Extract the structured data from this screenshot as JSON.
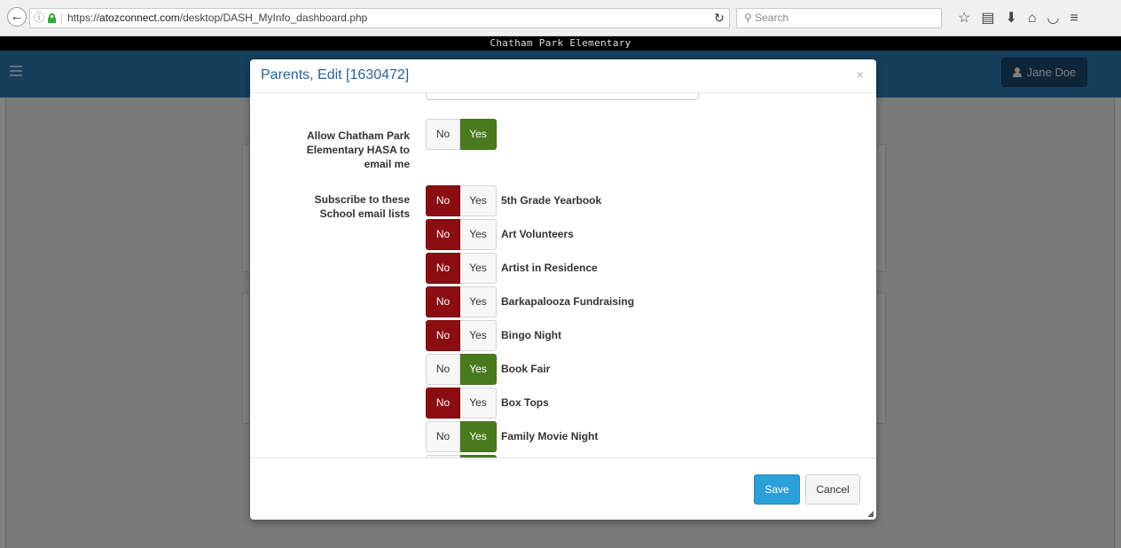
{
  "browser": {
    "url_prefix": "https://",
    "url_domain": "atozconnect.com",
    "url_path": "/desktop/DASH_MyInfo_dashboard.php",
    "search_placeholder": "Search"
  },
  "app": {
    "school_name": "Chatham Park Elementary",
    "user_name": "Jane Doe"
  },
  "modal": {
    "title": "Parents, Edit [1630472]",
    "close_label": "×",
    "allow_email": {
      "label": "Allow Chatham Park Elementary HASA to email me",
      "no_label": "No",
      "yes_label": "Yes",
      "value": "Yes"
    },
    "subscriptions": {
      "label": "Subscribe to these School email lists",
      "no_label": "No",
      "yes_label": "Yes",
      "lists": [
        {
          "name": "5th Grade Yearbook",
          "value": "No"
        },
        {
          "name": "Art Volunteers",
          "value": "No"
        },
        {
          "name": "Artist in Residence",
          "value": "No"
        },
        {
          "name": "Barkapalooza Fundraising",
          "value": "No"
        },
        {
          "name": "Bingo Night",
          "value": "No"
        },
        {
          "name": "Book Fair",
          "value": "Yes"
        },
        {
          "name": "Box Tops",
          "value": "No"
        },
        {
          "name": "Family Movie Night",
          "value": "Yes"
        },
        {
          "name": "",
          "value": "Yes"
        }
      ]
    },
    "save_label": "Save",
    "cancel_label": "Cancel"
  },
  "colors": {
    "nav_blue": "#2c7fb8",
    "title_blue": "#2a6496",
    "no_active": "#8b0d12",
    "yes_active": "#4a7a1e",
    "save_blue": "#2a9fd8",
    "user_button": "#1a4a70"
  }
}
